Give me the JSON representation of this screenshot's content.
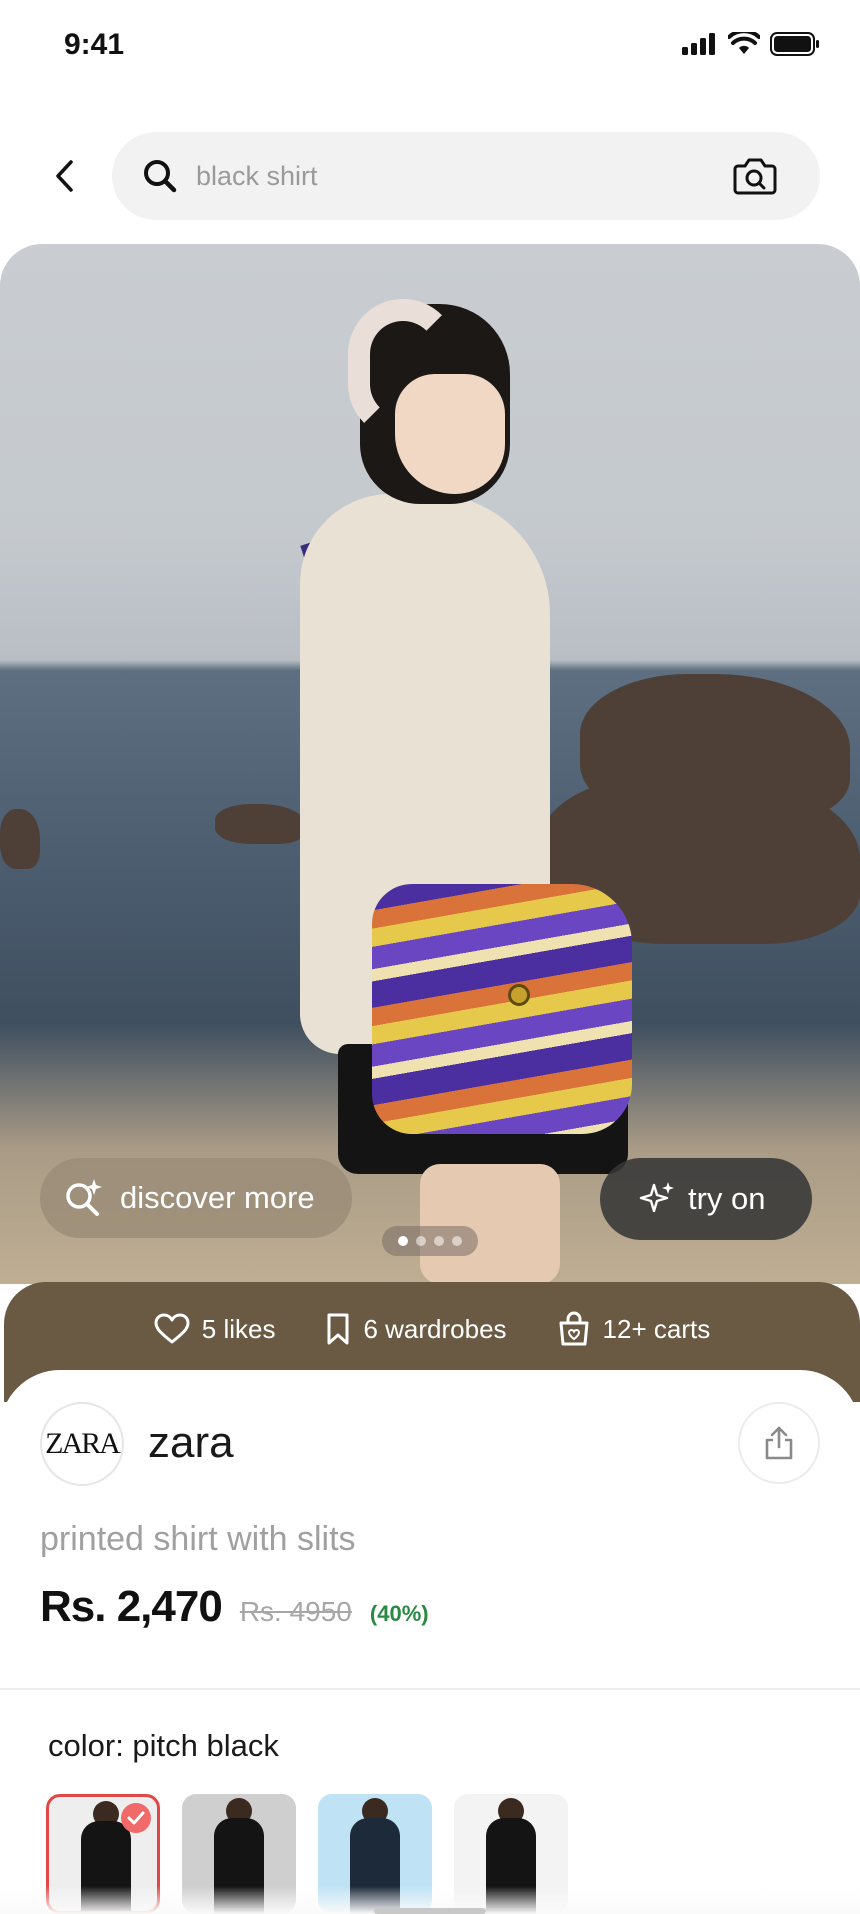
{
  "status_bar": {
    "time": "9:41"
  },
  "search": {
    "placeholder": "black shirt"
  },
  "hero": {
    "discover_label": "discover more",
    "try_on_label": "try on",
    "carousel": {
      "total": 4,
      "active_index": 0
    }
  },
  "stats": {
    "likes": "5 likes",
    "wardrobes": "6 wardrobes",
    "carts": "12+ carts"
  },
  "brand": {
    "logo_text": "ZARA",
    "name": "zara"
  },
  "product": {
    "title": "printed shirt with slits",
    "price": "Rs. 2,470",
    "original_price": "Rs. 4950",
    "discount": "(40%)"
  },
  "color": {
    "label": "color: pitch black",
    "swatches": [
      {
        "bg": "#eeeeee",
        "selected": true
      },
      {
        "bg": "#cfcfcf",
        "selected": false
      },
      {
        "bg": "#bfe3f5",
        "selected": false
      },
      {
        "bg": "#f3f3f3",
        "selected": false
      }
    ]
  },
  "colors": {
    "accent_red": "#e04848",
    "discount_green": "#2a8a43",
    "stats_bar": "#6b5a43"
  }
}
